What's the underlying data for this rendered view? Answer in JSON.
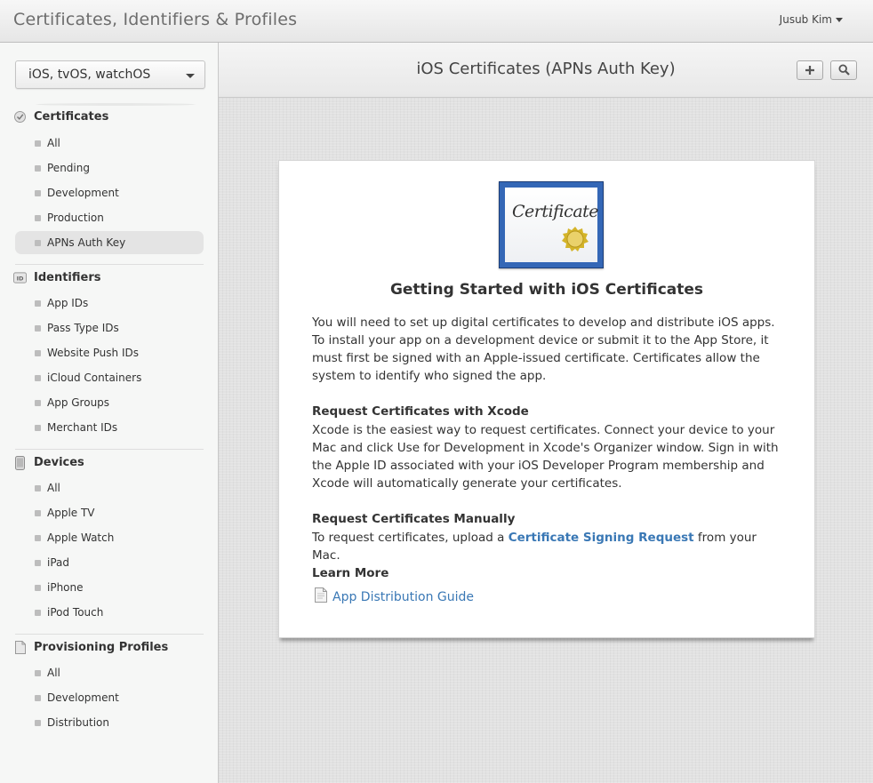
{
  "header": {
    "title": "Certificates, Identifiers & Profiles",
    "user_name": "Jusub Kim"
  },
  "sidebar": {
    "platform": "iOS, tvOS, watchOS",
    "sections": [
      {
        "title": "Certificates",
        "icon": "certificate-badge-icon",
        "items": [
          "All",
          "Pending",
          "Development",
          "Production",
          "APNs Auth Key"
        ],
        "selected": "APNs Auth Key"
      },
      {
        "title": "Identifiers",
        "icon": "id-card-icon",
        "items": [
          "App IDs",
          "Pass Type IDs",
          "Website Push IDs",
          "iCloud Containers",
          "App Groups",
          "Merchant IDs"
        ]
      },
      {
        "title": "Devices",
        "icon": "phone-icon",
        "items": [
          "All",
          "Apple TV",
          "Apple Watch",
          "iPad",
          "iPhone",
          "iPod Touch"
        ]
      },
      {
        "title": "Provisioning Profiles",
        "icon": "document-icon",
        "items": [
          "All",
          "Development",
          "Distribution"
        ]
      }
    ]
  },
  "main": {
    "title": "iOS Certificates (APNs Auth Key)",
    "add_icon": "plus-icon",
    "search_icon": "search-icon"
  },
  "card": {
    "image_text": "Certificate",
    "heading": "Getting Started with iOS Certificates",
    "intro": "You will need to set up digital certificates to develop and distribute iOS apps. To install your app on a development device or submit it to the App Store, it must first be signed with an Apple-issued certificate. Certificates allow the system to identify who signed the app.",
    "xcode_heading": "Request Certificates with Xcode",
    "xcode_text": "Xcode is the easiest way to request certificates. Connect your device to your Mac and click Use for Development in Xcode's Organizer window. Sign in with the Apple ID associated with your iOS Developer Program membership and Xcode will automatically generate your certificates.",
    "manual_heading": "Request Certificates Manually",
    "manual_prefix": "To request certificates, upload a",
    "manual_link": "Certificate Signing Request",
    "manual_suffix": "from your Mac.",
    "learn_heading": "Learn More",
    "guide_link": "App Distribution Guide"
  },
  "colors": {
    "link": "#3a78b5",
    "certificate_frame": "#3467b6"
  }
}
